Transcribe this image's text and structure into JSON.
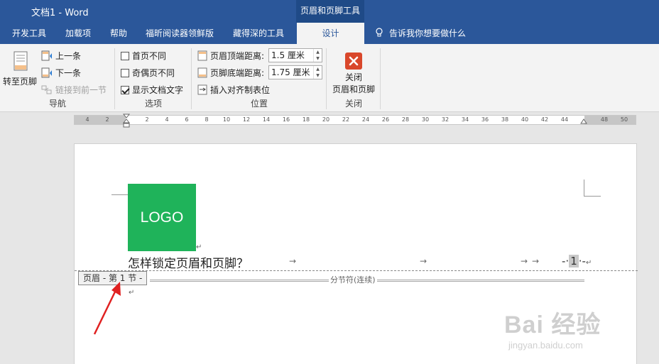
{
  "window": {
    "title": "文档1  -  Word",
    "contextual_tab_group": "页眉和页脚工具"
  },
  "tabs": [
    {
      "label": "开发工具"
    },
    {
      "label": "加载项"
    },
    {
      "label": "帮助"
    },
    {
      "label": "福昕阅读器领鲜版"
    },
    {
      "label": "藏得深的工具"
    },
    {
      "label": "设计",
      "active": true
    }
  ],
  "tell_me": "告诉我你想要做什么",
  "ribbon": {
    "navigation": {
      "label": "导航",
      "goto_footer": "转至页脚",
      "previous": "上一条",
      "next": "下一条",
      "link_to_previous": "链接到前一节"
    },
    "options": {
      "label": "选项",
      "different_first_page": {
        "label": "首页不同",
        "checked": false
      },
      "different_odd_even": {
        "label": "奇偶页不同",
        "checked": false
      },
      "show_document_text": {
        "label": "显示文档文字",
        "checked": true
      }
    },
    "position": {
      "label": "位置",
      "header_from_top_label": "页眉顶端距离:",
      "header_from_top_value": "1.5 厘米",
      "footer_from_bottom_label": "页脚底端距离:",
      "footer_from_bottom_value": "1.75 厘米",
      "insert_alignment_tab": "插入对齐制表位"
    },
    "close": {
      "label": "关闭",
      "button_line1": "关闭",
      "button_line2": "页眉和页脚"
    }
  },
  "ruler": {
    "ticks": [
      "4",
      "2",
      "2",
      "4",
      "6",
      "8",
      "10",
      "12",
      "14",
      "16",
      "18",
      "20",
      "22",
      "24",
      "26",
      "28",
      "30",
      "32",
      "34",
      "36",
      "38",
      "40",
      "42",
      "44",
      "48",
      "50"
    ]
  },
  "document": {
    "logo_text": "LOGO",
    "headline": "怎样锁定页眉和页脚？",
    "page_number": "1",
    "page_number_prefix": "-",
    "page_number_suffix": "-",
    "header_tag": "页眉 - 第 1 节 -",
    "section_break": "分节符(连续)",
    "tab_arrow": "→",
    "para_mark": "↵"
  },
  "watermark": {
    "brand": "Bai 经验",
    "url": "jingyan.baidu.com"
  },
  "colors": {
    "titlebar": "#2b579a",
    "logo_bg": "#1fb35a",
    "close_icon": "#d9472b",
    "arrow": "#e02020"
  }
}
